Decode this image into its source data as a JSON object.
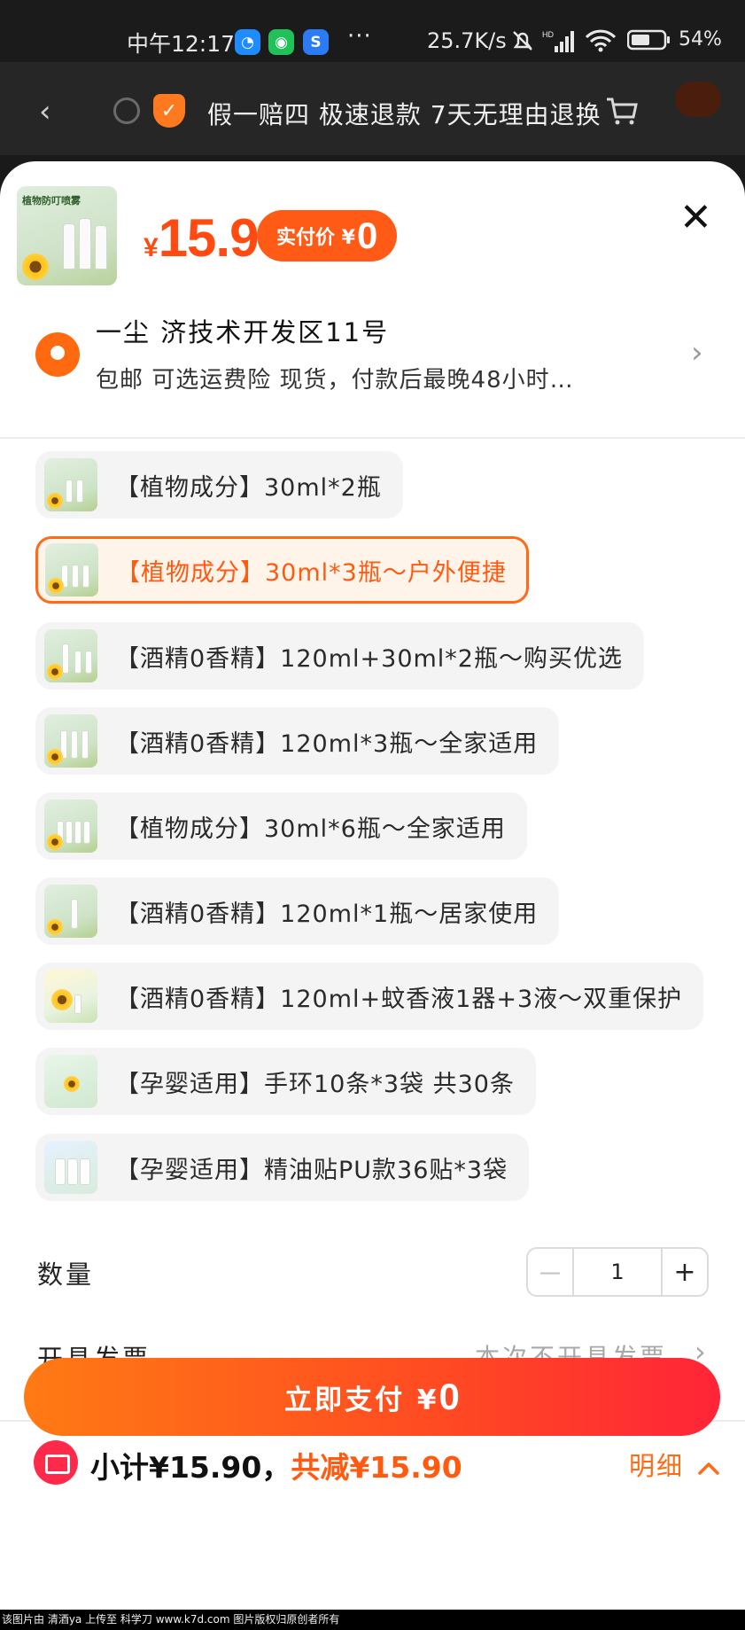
{
  "status_bar": {
    "time": "中午12:17",
    "more": "···",
    "net_speed": "25.7K/s",
    "battery": "54%"
  },
  "background_header": {
    "guarantee": "假一赔四 极速退款 7天无理由退换",
    "back_icon": "chevron-left-icon",
    "cart_icon": "cart-icon"
  },
  "product": {
    "price_currency": "¥",
    "price": "15.9",
    "actual_pay_label": "实付价 ¥",
    "actual_pay_value": "0"
  },
  "address": {
    "title": "一尘 济技术开发区11号",
    "subtitle": "包邮 可选运费险 现货，付款后最晚48小时…"
  },
  "options": [
    {
      "label": "【植物成分】30ml*2瓶",
      "selected": false
    },
    {
      "label": "【植物成分】30ml*3瓶～户外便捷",
      "selected": true
    },
    {
      "label": "【酒精0香精】120ml+30ml*2瓶～购买优选",
      "selected": false
    },
    {
      "label": "【酒精0香精】120ml*3瓶～全家适用",
      "selected": false
    },
    {
      "label": "【植物成分】30ml*6瓶～全家适用",
      "selected": false
    },
    {
      "label": "【酒精0香精】120ml*1瓶～居家使用",
      "selected": false
    },
    {
      "label": "【酒精0香精】120ml+蚊香液1器+3液～双重保护",
      "selected": false
    },
    {
      "label": "【孕婴适用】手环10条*3袋 共30条",
      "selected": false
    },
    {
      "label": "【孕婴适用】精油贴PU款36贴*3袋",
      "selected": false
    }
  ],
  "quantity": {
    "label": "数量",
    "minus": "－",
    "value": "1",
    "plus": "+"
  },
  "invoice": {
    "label": "开具发票",
    "value": "本次不开具发票"
  },
  "summary": {
    "subtotal": "小计¥15.90，",
    "discount": "共减¥15.90",
    "detail": "明细"
  },
  "pay_button": {
    "label": "立即支付 ¥",
    "amount": "0"
  },
  "watermark": "该图片由 清酒ya 上传至 科学刀 www.k7d.com 图片版权归原创者所有",
  "colors": {
    "accent": "#ff5a16",
    "discount": "#ff5a10",
    "pay_gradient_start": "#ff7a14",
    "pay_gradient_end": "#ff2438"
  }
}
